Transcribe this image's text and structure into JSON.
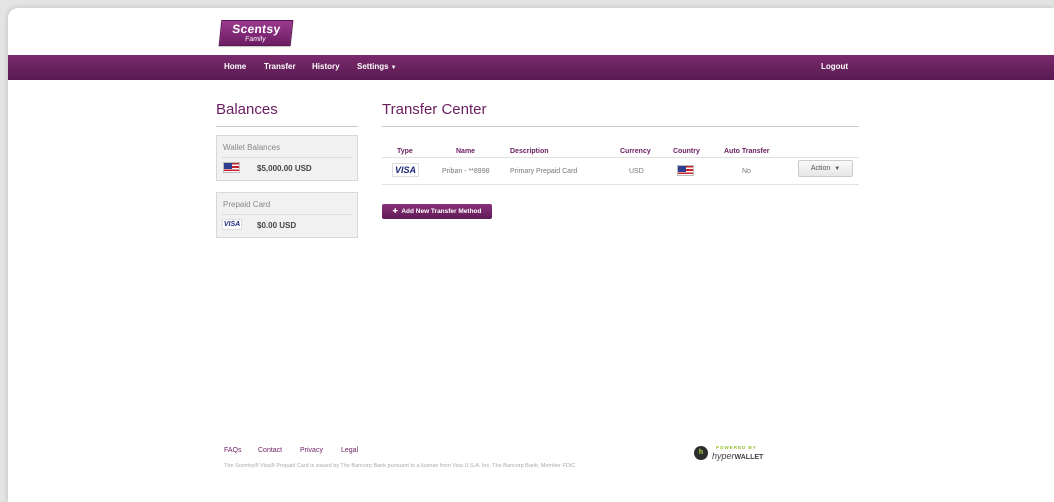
{
  "brand": {
    "name": "Scentsy",
    "sub": "Family"
  },
  "nav": {
    "home": "Home",
    "transfer": "Transfer",
    "history": "History",
    "settings": "Settings",
    "logout": "Logout"
  },
  "balances": {
    "title": "Balances",
    "wallet": {
      "label": "Wallet Balances",
      "amount": "$5,000.00 USD"
    },
    "prepaid": {
      "label": "Prepaid Card",
      "amount": "$0.00 USD"
    }
  },
  "transfer": {
    "title": "Transfer Center",
    "headers": [
      "Type",
      "Name",
      "Description",
      "Currency",
      "Country",
      "Auto Transfer"
    ],
    "rows": [
      {
        "type": "VISA",
        "name": "Priban - **8998",
        "description": "Primary Prepaid Card",
        "currency": "USD",
        "country_icon": "us-flag-icon",
        "auto_transfer": "No",
        "action": "Action"
      }
    ],
    "add_button": "Add New Transfer Method"
  },
  "footer": {
    "links": [
      "FAQs",
      "Contact",
      "Privacy",
      "Legal"
    ],
    "disclaimer": "The Scentsy® Visa® Prepaid Card is issued by The Bancorp Bank pursuant to a license from Visa U.S.A. Inc. The Bancorp Bank; Member FDIC.",
    "powered": "POWERED BY",
    "hyper": "hyper",
    "wallet": "WALLET"
  },
  "colors": {
    "brand": "#6a1d5f",
    "nav": "#6b2262"
  }
}
